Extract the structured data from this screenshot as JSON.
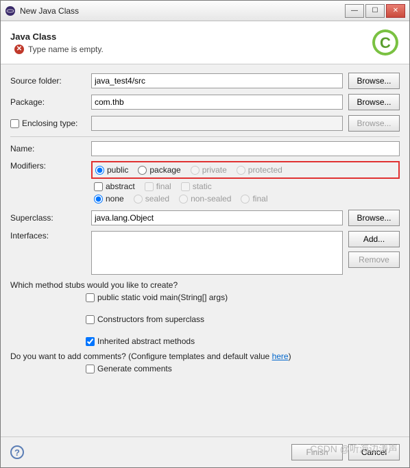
{
  "window": {
    "title": "New Java Class"
  },
  "banner": {
    "title": "Java Class",
    "message": "Type name is empty."
  },
  "labels": {
    "source_folder": "Source folder:",
    "package": "Package:",
    "enclosing_type": "Enclosing type:",
    "name": "Name:",
    "modifiers": "Modifiers:",
    "superclass": "Superclass:",
    "interfaces": "Interfaces:",
    "stubs_q": "Which method stubs would you like to create?",
    "main_stub": "public static void main(String[] args)",
    "ctor_stub": "Constructors from superclass",
    "inherited_stub": "Inherited abstract methods",
    "comments_q": "Do you want to add comments? (Configure templates and default value ",
    "here": "here",
    "paren_close": ")",
    "gen_comments": "Generate comments"
  },
  "modifiers": {
    "public": "public",
    "package": "package",
    "private": "private",
    "protected": "protected",
    "abstract": "abstract",
    "final": "final",
    "static": "static",
    "none": "none",
    "sealed": "sealed",
    "non_sealed": "non-sealed",
    "final2": "final"
  },
  "values": {
    "source_folder": "java_test4/src",
    "package": "com.thb",
    "enclosing_type": "",
    "name": "",
    "superclass": "java.lang.Object"
  },
  "buttons": {
    "browse": "Browse...",
    "add": "Add...",
    "remove": "Remove",
    "finish": "Finish",
    "cancel": "Cancel"
  },
  "watermark": "CSDN @听海边涛声"
}
